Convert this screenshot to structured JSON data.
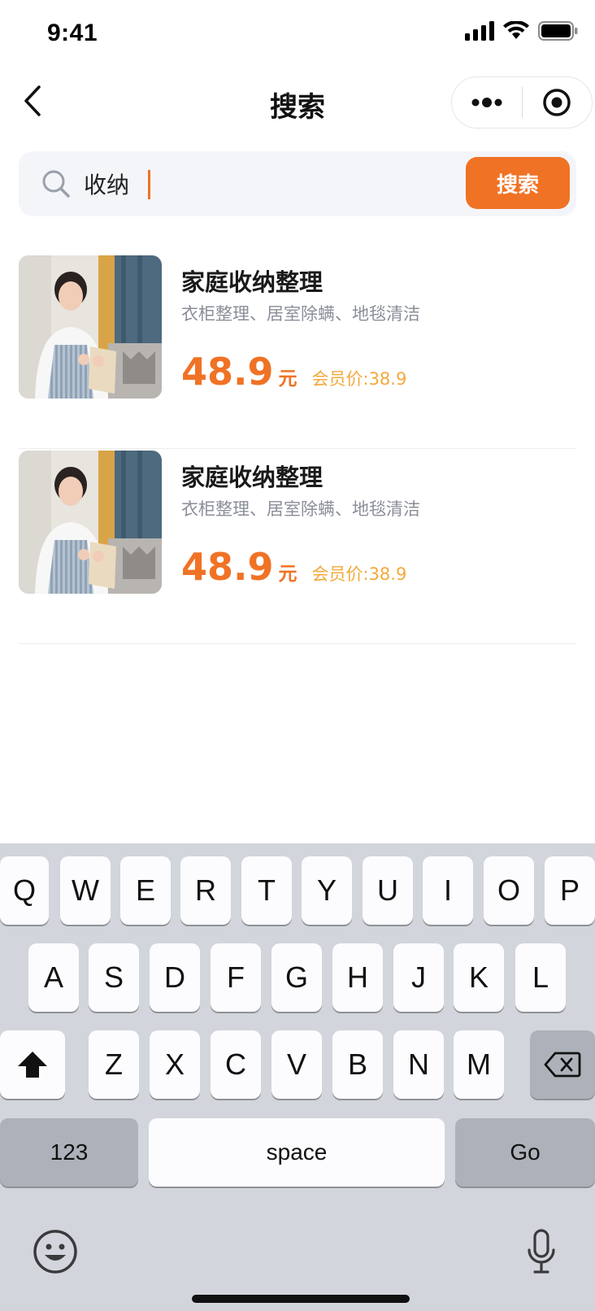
{
  "status_bar": {
    "time": "9:41",
    "icons": [
      "signal-icon",
      "wifi-icon",
      "battery-icon"
    ]
  },
  "nav": {
    "title": "搜索",
    "back_icon": "chevron-left-icon",
    "more_icon": "more-dots-icon",
    "target_icon": "target-icon"
  },
  "search": {
    "value": "收纳",
    "placeholder": "",
    "button_label": "搜索",
    "icon": "search-icon"
  },
  "results": [
    {
      "title": "家庭收纳整理",
      "desc": "衣柜整理、居室除螨、地毯清洁",
      "price": "48.9",
      "unit": "元",
      "member_price": "会员价:38.9"
    },
    {
      "title": "家庭收纳整理",
      "desc": "衣柜整理、居室除螨、地毯清洁",
      "price": "48.9",
      "unit": "元",
      "member_price": "会员价:38.9"
    }
  ],
  "keyboard": {
    "row1": [
      "Q",
      "W",
      "E",
      "R",
      "T",
      "Y",
      "U",
      "I",
      "O",
      "P"
    ],
    "row2": [
      "A",
      "S",
      "D",
      "F",
      "G",
      "H",
      "J",
      "K",
      "L"
    ],
    "row3": [
      "Z",
      "X",
      "C",
      "V",
      "B",
      "N",
      "M"
    ],
    "numbers_label": "123",
    "space_label": "space",
    "go_label": "Go"
  },
  "colors": {
    "accent": "#f07225",
    "member": "#f3a93b",
    "keyboard_bg": "#d2d5db"
  }
}
